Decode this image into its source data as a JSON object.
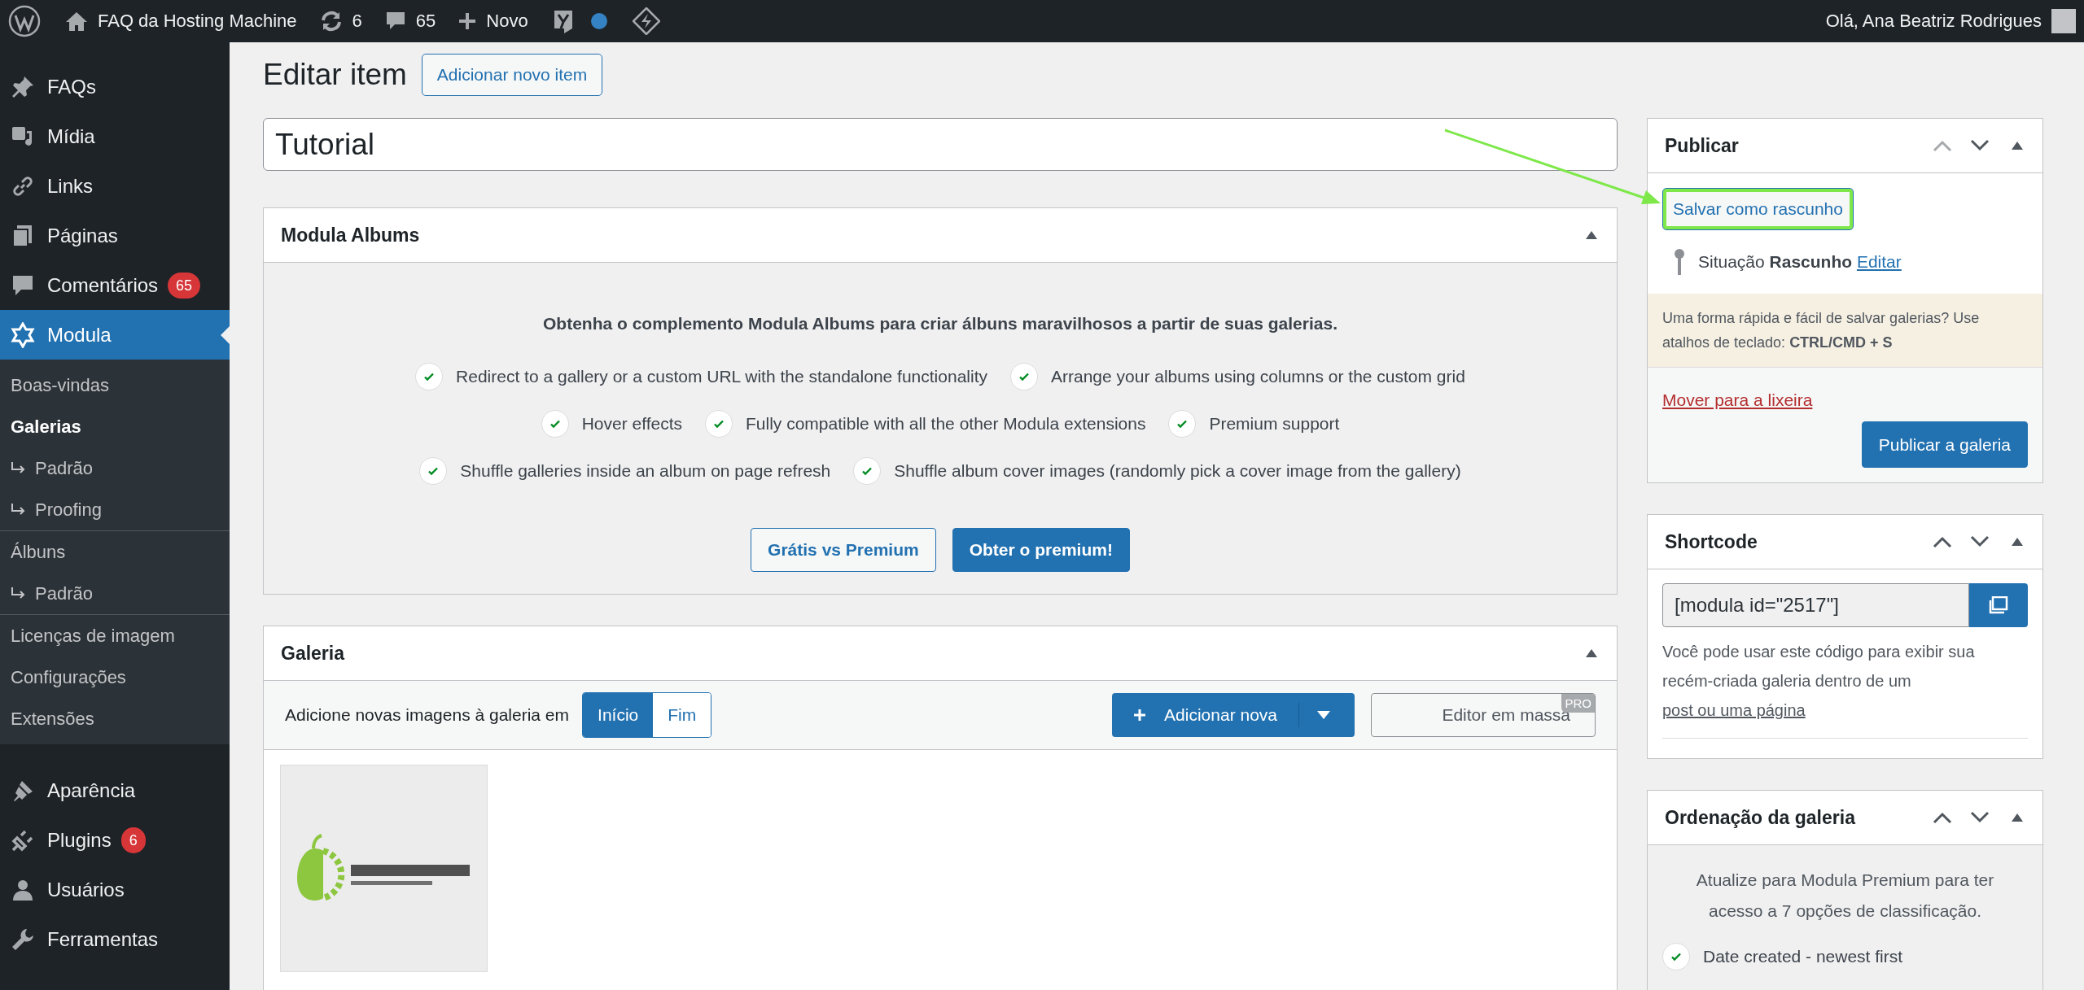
{
  "admin_bar": {
    "site_name": "FAQ da Hosting Machine",
    "updates": "6",
    "comments": "65",
    "new_label": "Novo",
    "greeting": "Olá, Ana Beatriz Rodrigues"
  },
  "sidebar": {
    "items": [
      {
        "label": "FAQs",
        "selected": false
      },
      {
        "label": "Mídia",
        "selected": false
      },
      {
        "label": "Links",
        "selected": false
      },
      {
        "label": "Páginas",
        "selected": false
      },
      {
        "label": "Comentários",
        "selected": false,
        "badge": "65"
      },
      {
        "label": "Modula",
        "selected": true,
        "submenu": [
          {
            "items": [
              {
                "label": "Boas-vindas",
                "selected": false
              },
              {
                "label": "Galerias",
                "selected": true,
                "children": [
                  {
                    "label": "Padrão",
                    "selected": false
                  },
                  {
                    "label": "Proofing",
                    "selected": false
                  }
                ]
              }
            ]
          },
          {
            "items": [
              {
                "label": "Álbuns",
                "selected": false,
                "children": [
                  {
                    "label": "Padrão",
                    "selected": false
                  }
                ]
              }
            ]
          },
          {
            "items": [
              {
                "label": "Licenças de imagem",
                "selected": false
              },
              {
                "label": "Configurações",
                "selected": false
              },
              {
                "label": "Extensões",
                "selected": false
              }
            ]
          }
        ]
      },
      {
        "label": "Aparência",
        "selected": false
      },
      {
        "label": "Plugins",
        "selected": false,
        "badge": "6"
      },
      {
        "label": "Usuários",
        "selected": false
      },
      {
        "label": "Ferramentas",
        "selected": false
      }
    ]
  },
  "page": {
    "title": "Editar item",
    "add_new_button": "Adicionar novo item",
    "title_field": "Tutorial"
  },
  "modula_albums": {
    "title": "Modula Albums",
    "intro": "Obtenha o complemento Modula Albums para criar álbuns maravilhosos a partir de suas galerias.",
    "feature_rows": [
      [
        "Redirect to a gallery or a custom URL with the standalone functionality",
        "Arrange your albums using columns or the custom grid"
      ],
      [
        "Hover effects",
        "Fully compatible with all the other Modula extensions",
        "Premium support"
      ],
      [
        "Shuffle galleries inside an album on page refresh",
        "Shuffle album cover images (randomly pick a cover image from the gallery)"
      ]
    ],
    "buttons": [
      {
        "label": "Grátis vs Premium",
        "kind": "secondary"
      },
      {
        "label": "Obter o premium!",
        "kind": "primary"
      }
    ]
  },
  "gallery": {
    "title": "Galeria",
    "insert_label": "Adicione novas imagens à galeria em",
    "insert_positions": [
      {
        "label": "Início",
        "selected": true
      },
      {
        "label": "Fim",
        "selected": false
      }
    ],
    "add_button": "Adicionar nova",
    "bulk_editor": "Editor em massa",
    "pro_badge": "PRO"
  },
  "publish": {
    "title": "Publicar",
    "move_up_disabled": true,
    "save_draft": "Salvar como rascunho",
    "status_label": "Situação",
    "status_value": "Rascunho",
    "edit_link": "Editar",
    "notice": "Uma forma rápida e fácil de salvar galerias? Use atalhos de teclado: **CTRL/CMD + S**",
    "trash_link": "Mover para a lixeira",
    "publish_button": "Publicar a galeria"
  },
  "shortcode": {
    "title": "Shortcode",
    "move_up_disabled": false,
    "value": "[modula id=\"2517\"]",
    "description": "Você pode usar este código para exibir sua recém-criada galeria dentro de um",
    "link": "post ou uma página"
  },
  "sorting": {
    "title": "Ordenação da galeria",
    "move_up_disabled": false,
    "upsell": "Atualize para Modula Premium para ter acesso a 7 opções de classificação.",
    "options": [
      {
        "label": "Date created - newest first",
        "checked": true
      }
    ]
  }
}
